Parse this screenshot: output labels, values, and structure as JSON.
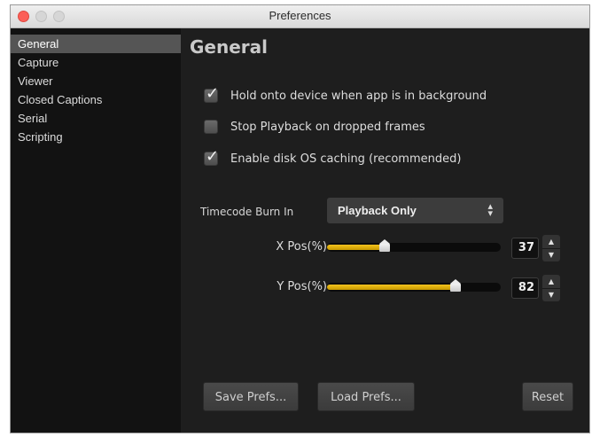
{
  "window": {
    "title": "Preferences"
  },
  "sidebar": {
    "items": [
      {
        "label": "General",
        "selected": true
      },
      {
        "label": "Capture"
      },
      {
        "label": "Viewer"
      },
      {
        "label": "Closed Captions"
      },
      {
        "label": "Serial"
      },
      {
        "label": "Scripting"
      }
    ]
  },
  "general": {
    "title": "General",
    "checkboxes": [
      {
        "label": "Hold onto device when app is in background",
        "checked": true
      },
      {
        "label": "Stop Playback on dropped frames",
        "checked": false
      },
      {
        "label": "Enable disk OS caching (recommended)",
        "checked": true
      }
    ],
    "timecode": {
      "label": "Timecode Burn In",
      "value": "Playback Only",
      "arrow_icon": "updown-chevron-icon"
    },
    "xpos": {
      "label": "X Pos(%)",
      "value": "37"
    },
    "ypos": {
      "label": "Y Pos(%)",
      "value": "82"
    }
  },
  "buttons": {
    "save": "Save Prefs...",
    "load": "Load Prefs...",
    "reset": "Reset"
  },
  "colors": {
    "accent": "#f2c21d",
    "background": "#1e1e1e",
    "sidebar": "#121212",
    "selected": "#555555"
  }
}
